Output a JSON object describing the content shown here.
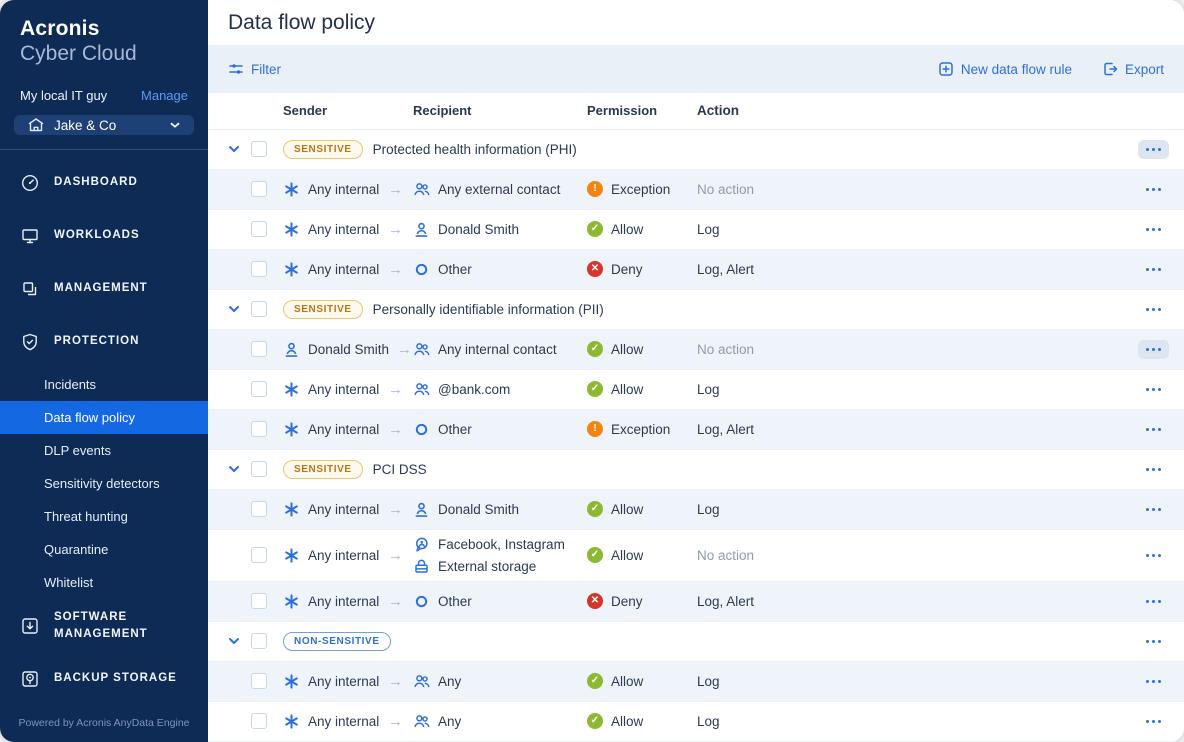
{
  "colors": {
    "accent_blue": "#2e6fdd",
    "sidebar_bg": "#0d2b55",
    "sidebar_active": "#1469e3",
    "allow": "#8db832",
    "deny": "#d6352b",
    "exception": "#f0860f",
    "sensitive_badge_text": "#b9770f",
    "row_alt_bg": "#eff4fa"
  },
  "sidebar": {
    "brand": {
      "line1": "Acronis",
      "line2": "Cyber Cloud"
    },
    "account": {
      "name": "My local IT guy",
      "manage_label": "Manage"
    },
    "tenant": {
      "name": "Jake & Co",
      "icon": "building-icon",
      "chevron": "chevron-down-icon"
    },
    "nav": [
      {
        "label": "DASHBOARD",
        "icon": "gauge"
      },
      {
        "label": "WORKLOADS",
        "icon": "monitor"
      },
      {
        "label": "MANAGEMENT",
        "icon": "squares"
      },
      {
        "label": "PROTECTION",
        "icon": "shield",
        "children": [
          {
            "label": "Incidents",
            "active": false
          },
          {
            "label": "Data flow policy",
            "active": true
          },
          {
            "label": "DLP events",
            "active": false
          },
          {
            "label": "Sensitivity detectors",
            "active": false
          },
          {
            "label": "Threat hunting",
            "active": false
          },
          {
            "label": "Quarantine",
            "active": false
          },
          {
            "label": "Whitelist",
            "active": false
          }
        ]
      },
      {
        "label": "SOFTWARE MANAGEMENT",
        "icon": "software"
      },
      {
        "label": "BACKUP STORAGE",
        "icon": "disk"
      }
    ],
    "footer": "Powered by Acronis AnyData Engine"
  },
  "header": {
    "title": "Data flow policy"
  },
  "toolbar": {
    "filter_label": "Filter",
    "new_rule_label": "New data flow rule",
    "export_label": "Export"
  },
  "table": {
    "columns": [
      "Sender",
      "Recipient",
      "Permission",
      "Action"
    ],
    "groups": [
      {
        "badge": "SENSITIVE",
        "badge_type": "sensitive",
        "title": "Protected health information (PHI)",
        "menu_highlighted": true,
        "rows": [
          {
            "sender": {
              "icon": "any",
              "label": "Any internal"
            },
            "recipients": [
              {
                "icon": "people",
                "label": "Any external contact"
              }
            ],
            "permission": {
              "type": "exception",
              "label": "Exception"
            },
            "action": "No action",
            "action_muted": true,
            "menu_highlighted": false
          },
          {
            "sender": {
              "icon": "any",
              "label": "Any internal"
            },
            "recipients": [
              {
                "icon": "person",
                "label": "Donald Smith"
              }
            ],
            "permission": {
              "type": "allow",
              "label": "Allow"
            },
            "action": "Log",
            "action_muted": false,
            "menu_highlighted": false
          },
          {
            "sender": {
              "icon": "any",
              "label": "Any internal"
            },
            "recipients": [
              {
                "icon": "other",
                "label": "Other"
              }
            ],
            "permission": {
              "type": "deny",
              "label": "Deny"
            },
            "action": "Log, Alert",
            "action_muted": false,
            "menu_highlighted": false
          }
        ]
      },
      {
        "badge": "SENSITIVE",
        "badge_type": "sensitive",
        "title": "Personally identifiable information (PII)",
        "menu_highlighted": false,
        "rows": [
          {
            "sender": {
              "icon": "person",
              "label": "Donald Smith"
            },
            "recipients": [
              {
                "icon": "people",
                "label": "Any internal contact"
              }
            ],
            "permission": {
              "type": "allow",
              "label": "Allow"
            },
            "action": "No action",
            "action_muted": true,
            "menu_highlighted": true
          },
          {
            "sender": {
              "icon": "any",
              "label": "Any internal"
            },
            "recipients": [
              {
                "icon": "people",
                "label": "@bank.com"
              }
            ],
            "permission": {
              "type": "allow",
              "label": "Allow"
            },
            "action": "Log",
            "action_muted": false,
            "menu_highlighted": false
          },
          {
            "sender": {
              "icon": "any",
              "label": "Any internal"
            },
            "recipients": [
              {
                "icon": "other",
                "label": "Other"
              }
            ],
            "permission": {
              "type": "exception",
              "label": "Exception"
            },
            "action": "Log, Alert",
            "action_muted": false,
            "menu_highlighted": false
          }
        ]
      },
      {
        "badge": "SENSITIVE",
        "badge_type": "sensitive",
        "title": "PCI DSS",
        "menu_highlighted": false,
        "rows": [
          {
            "sender": {
              "icon": "any",
              "label": "Any internal"
            },
            "recipients": [
              {
                "icon": "person",
                "label": "Donald Smith"
              }
            ],
            "permission": {
              "type": "allow",
              "label": "Allow"
            },
            "action": "Log",
            "action_muted": false,
            "menu_highlighted": false
          },
          {
            "sender": {
              "icon": "any",
              "label": "Any internal"
            },
            "recipients": [
              {
                "icon": "social",
                "label": "Facebook, Instagram"
              },
              {
                "icon": "storage",
                "label": "External storage"
              }
            ],
            "permission": {
              "type": "allow",
              "label": "Allow"
            },
            "action": "No action",
            "action_muted": true,
            "menu_highlighted": false,
            "tall": true
          },
          {
            "sender": {
              "icon": "any",
              "label": "Any internal"
            },
            "recipients": [
              {
                "icon": "other",
                "label": "Other"
              }
            ],
            "permission": {
              "type": "deny",
              "label": "Deny"
            },
            "action": "Log, Alert",
            "action_muted": false,
            "menu_highlighted": false
          }
        ]
      },
      {
        "badge": "NON-SENSITIVE",
        "badge_type": "non-sensitive",
        "title": "",
        "menu_highlighted": false,
        "rows": [
          {
            "sender": {
              "icon": "any",
              "label": "Any internal"
            },
            "recipients": [
              {
                "icon": "people",
                "label": "Any"
              }
            ],
            "permission": {
              "type": "allow",
              "label": "Allow"
            },
            "action": "Log",
            "action_muted": false,
            "menu_highlighted": false
          },
          {
            "sender": {
              "icon": "any",
              "label": "Any internal"
            },
            "recipients": [
              {
                "icon": "people",
                "label": "Any"
              }
            ],
            "permission": {
              "type": "allow",
              "label": "Allow"
            },
            "action": "Log",
            "action_muted": false,
            "menu_highlighted": false,
            "partial": true
          }
        ]
      }
    ]
  }
}
